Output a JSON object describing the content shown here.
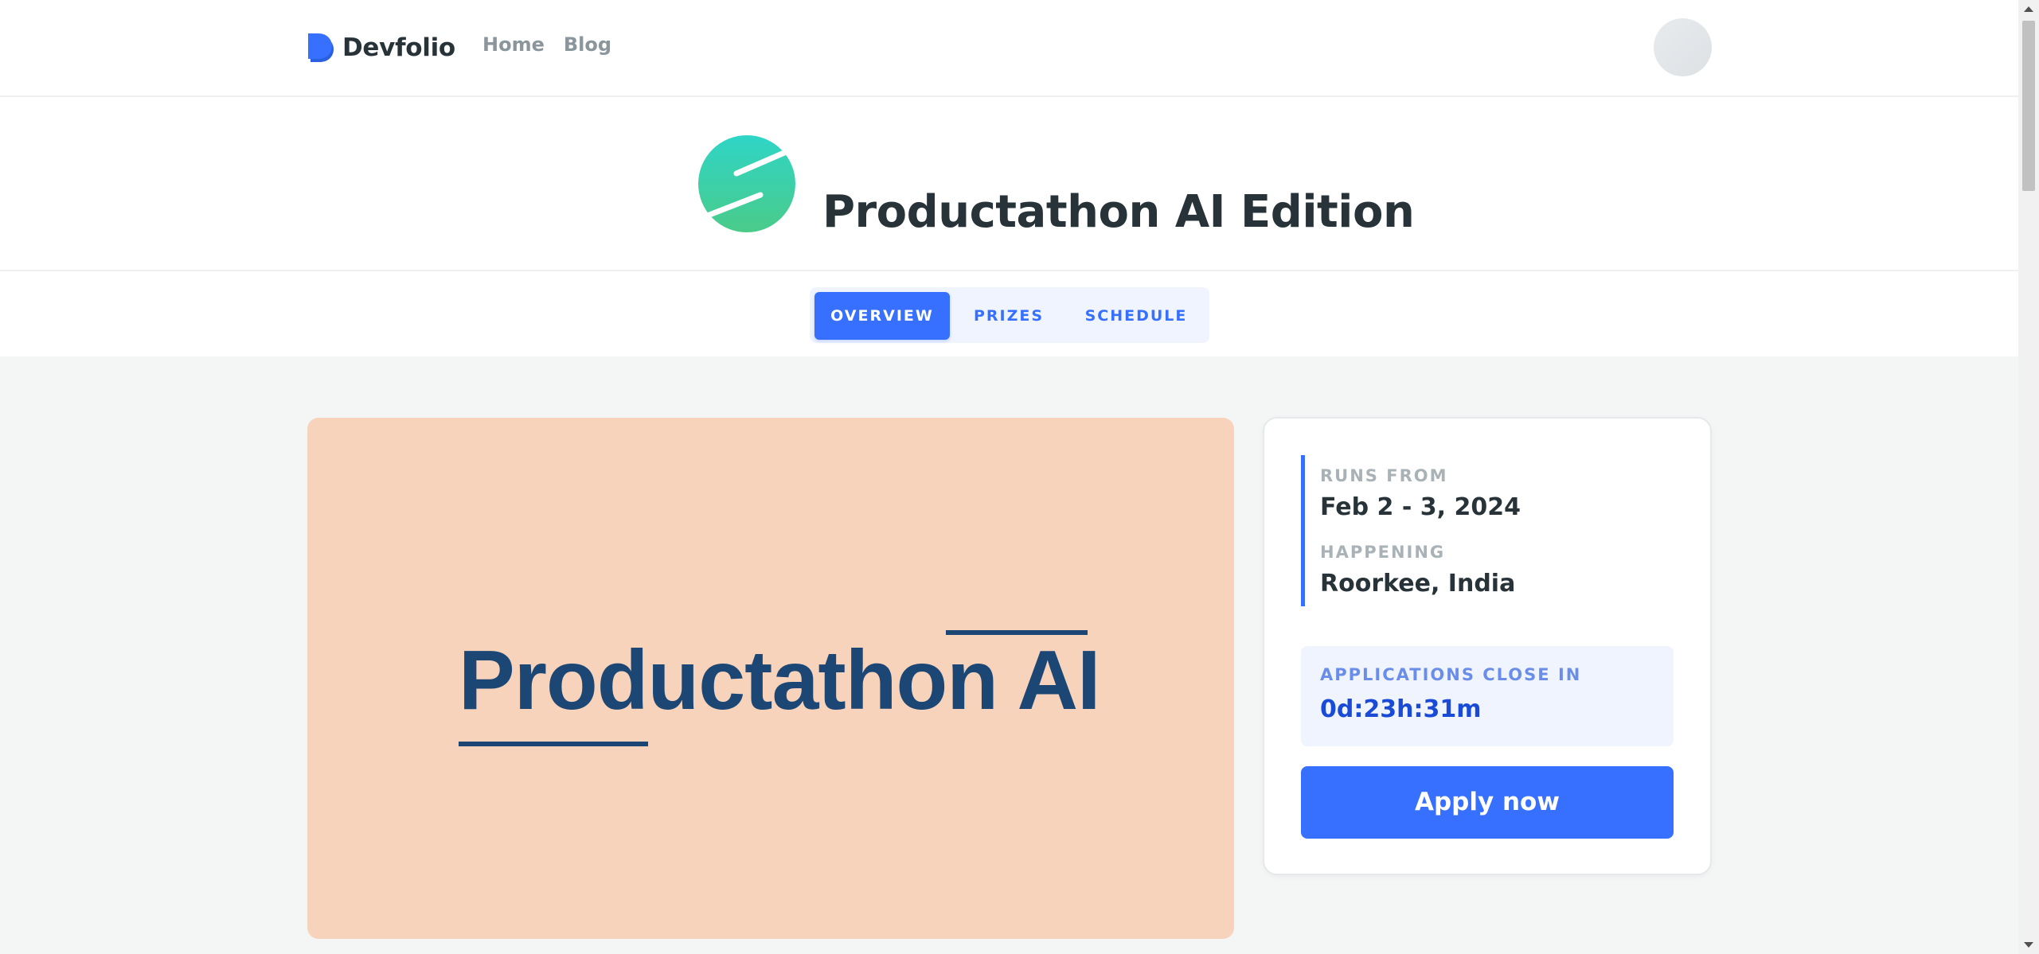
{
  "brand": {
    "name": "Devfolio",
    "accent": "#3770ff"
  },
  "nav": {
    "links": [
      "Home",
      "Blog"
    ]
  },
  "hackathon": {
    "title": "Productathon AI Edition",
    "logo_colors": [
      "#2fd5c6",
      "#4acb8a"
    ]
  },
  "tabs": [
    {
      "label": "OVERVIEW",
      "active": true
    },
    {
      "label": "PRIZES",
      "active": false
    },
    {
      "label": "SCHEDULE",
      "active": false
    }
  ],
  "banner": {
    "text": "Productathon AI",
    "background": "#f8d3bc",
    "text_color": "#1c4775"
  },
  "info": {
    "runs_from_label": "RUNS FROM",
    "runs_from_value": "Feb 2 - 3, 2024",
    "happening_label": "HAPPENING",
    "happening_value": "Roorkee, India"
  },
  "countdown": {
    "label": "APPLICATIONS CLOSE IN",
    "value": "0d:23h:31m"
  },
  "apply_button": {
    "label": "Apply now"
  }
}
